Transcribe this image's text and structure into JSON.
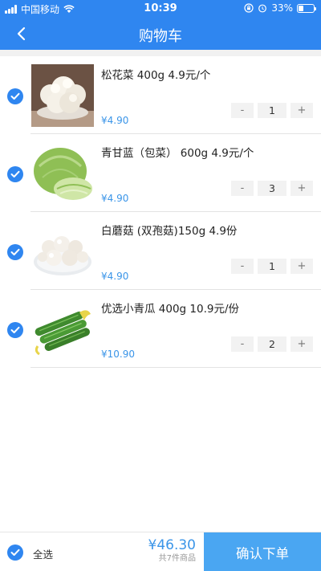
{
  "status_bar": {
    "carrier": "中国移动",
    "time": "10:39",
    "battery_percent": "33%",
    "battery_level": 0.33,
    "icons": [
      "signal-icon",
      "wifi-icon",
      "orientation-lock-icon",
      "alarm-icon",
      "battery-icon"
    ]
  },
  "nav": {
    "title": "购物车",
    "back_icon": "chevron-left-icon"
  },
  "items": [
    {
      "name": "松花菜 400g      4.9元/个",
      "price": "¥4.90",
      "qty": "1",
      "minus": "-",
      "plus": "+",
      "image": "cauliflower",
      "selected": true
    },
    {
      "name": "青甘蓝（包菜）  600g    4.9元/个",
      "price": "¥4.90",
      "qty": "3",
      "minus": "-",
      "plus": "+",
      "image": "cabbage",
      "selected": true
    },
    {
      "name": "白蘑菇 (双孢菇)150g       4.9份",
      "price": "¥4.90",
      "qty": "1",
      "minus": "-",
      "plus": "+",
      "image": "mushrooms",
      "selected": true
    },
    {
      "name": "优选小青瓜 400g       10.9元/份",
      "price": "¥10.90",
      "qty": "2",
      "minus": "-",
      "plus": "+",
      "image": "cucumbers",
      "selected": true
    }
  ],
  "footer": {
    "select_all_label": "全选",
    "select_all_checked": true,
    "total": "¥46.30",
    "count_label": "共7件商品",
    "confirm_label": "确认下单"
  },
  "colors": {
    "primary": "#2f86f0",
    "price": "#3b95e8",
    "confirm_button": "#4aa6f2"
  }
}
